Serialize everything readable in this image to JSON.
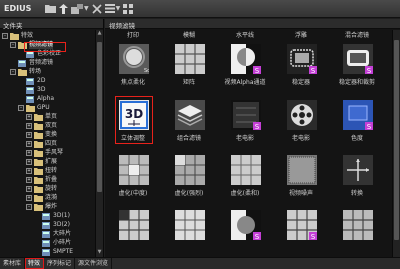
{
  "app": {
    "title": "EDIUS"
  },
  "toolbar": {
    "buttons": [
      "folder-icon",
      "up-arrow-icon",
      "import-icon",
      "delete-icon",
      "list-view-icon",
      "tile-view-icon"
    ]
  },
  "left_panel": {
    "title": "文件夹",
    "tree": [
      {
        "label": "特效",
        "level": 0,
        "expand": "-",
        "highlight": false
      },
      {
        "label": "视频滤镜",
        "level": 1,
        "expand": "-",
        "highlight": true
      },
      {
        "label": "色彩校正",
        "level": 2,
        "expand": "",
        "highlight": false
      },
      {
        "label": "音频滤镜",
        "level": 1,
        "expand": "",
        "highlight": false
      },
      {
        "label": "转场",
        "level": 1,
        "expand": "-",
        "highlight": false
      },
      {
        "label": "2D",
        "level": 2,
        "expand": "",
        "highlight": false
      },
      {
        "label": "3D",
        "level": 2,
        "expand": "",
        "highlight": false
      },
      {
        "label": "Alpha",
        "level": 2,
        "expand": "",
        "highlight": false
      },
      {
        "label": "GPU",
        "level": 2,
        "expand": "-",
        "highlight": false
      },
      {
        "label": "单页",
        "level": 3,
        "expand": "+",
        "highlight": false
      },
      {
        "label": "双页",
        "level": 3,
        "expand": "+",
        "highlight": false
      },
      {
        "label": "变换",
        "level": 3,
        "expand": "+",
        "highlight": false
      },
      {
        "label": "四页",
        "level": 3,
        "expand": "+",
        "highlight": false
      },
      {
        "label": "手风琴",
        "level": 3,
        "expand": "+",
        "highlight": false
      },
      {
        "label": "扩展",
        "level": 3,
        "expand": "+",
        "highlight": false
      },
      {
        "label": "扭转",
        "level": 3,
        "expand": "+",
        "highlight": false
      },
      {
        "label": "折叠",
        "level": 3,
        "expand": "+",
        "highlight": false
      },
      {
        "label": "旋转",
        "level": 3,
        "expand": "+",
        "highlight": false
      },
      {
        "label": "涟漪",
        "level": 3,
        "expand": "+",
        "highlight": false
      },
      {
        "label": "爆炸",
        "level": 3,
        "expand": "-",
        "highlight": false
      },
      {
        "label": "3D(1)",
        "level": 4,
        "expand": "",
        "highlight": false
      },
      {
        "label": "3D(2)",
        "level": 4,
        "expand": "",
        "highlight": false
      },
      {
        "label": "大碎片",
        "level": 4,
        "expand": "",
        "highlight": false
      },
      {
        "label": "小碎片",
        "level": 4,
        "expand": "",
        "highlight": false
      },
      {
        "label": "SMPTE",
        "level": 4,
        "expand": "",
        "highlight": false
      }
    ]
  },
  "right_panel": {
    "title": "视频滤镜",
    "top_labels": [
      "打印",
      "模糊",
      "水平线",
      "浮雕",
      "混合滤镜"
    ],
    "cells": [
      {
        "label": "焦点柔化",
        "icon": "soft-focus"
      },
      {
        "label": "矩阵",
        "icon": "matrix"
      },
      {
        "label": "视频Alpha通道",
        "icon": "alpha-channel"
      },
      {
        "label": "稳定器",
        "icon": "stabilizer"
      },
      {
        "label": "稳定器和裁剪",
        "icon": "stabilizer-crop"
      },
      {
        "label": "立体调整",
        "icon": "3d-adjust"
      },
      {
        "label": "组合滤镜",
        "icon": "combine-filter"
      },
      {
        "label": "老电影",
        "icon": "old-film"
      },
      {
        "label": "老电影",
        "icon": "film-reel"
      },
      {
        "label": "色度",
        "icon": "chroma"
      },
      {
        "label": "虚化(中度)",
        "icon": "blur-medium"
      },
      {
        "label": "虚化(强烈)",
        "icon": "blur-strong"
      },
      {
        "label": "虚化(柔和)",
        "icon": "blur-soft"
      },
      {
        "label": "视频噪声",
        "icon": "video-noise"
      },
      {
        "label": "转换",
        "icon": "transform"
      },
      {
        "label": "",
        "icon": "grid-a"
      },
      {
        "label": "",
        "icon": "grid-b"
      },
      {
        "label": "",
        "icon": "half-circle"
      },
      {
        "label": "",
        "icon": "grid-c"
      },
      {
        "label": "",
        "icon": "grid-d"
      }
    ]
  },
  "bottom_tabs": [
    {
      "label": "素材库",
      "active": false
    },
    {
      "label": "特效",
      "active": true
    },
    {
      "label": "序列标记",
      "active": false
    },
    {
      "label": "源文件浏览",
      "active": false
    }
  ],
  "colors": {
    "highlight": "#e8221b",
    "badge": "#c43fd6",
    "selected_thumb": "#2a6fd6"
  }
}
